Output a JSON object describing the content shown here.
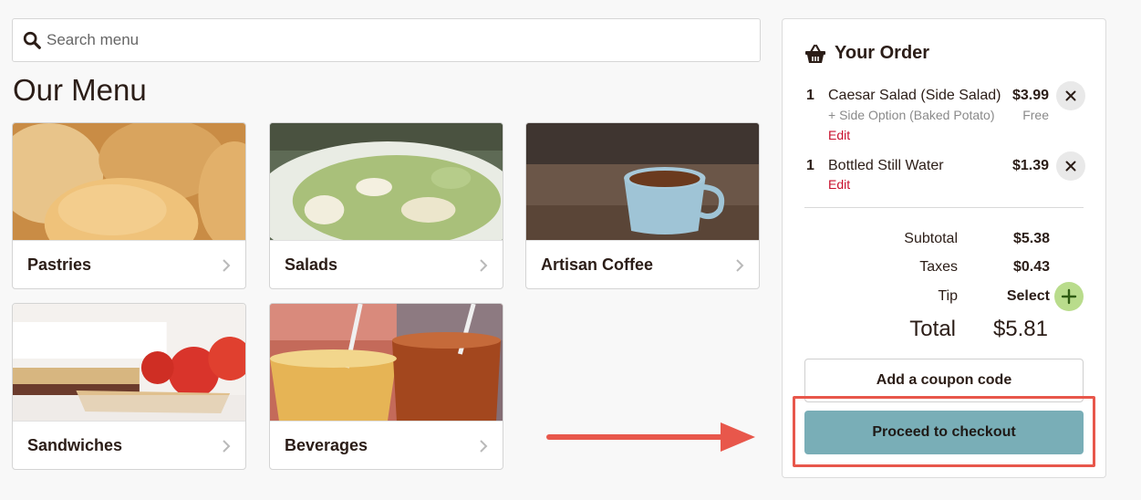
{
  "search": {
    "placeholder": "Search menu"
  },
  "menu": {
    "title": "Our Menu",
    "categories": [
      {
        "label": "Pastries"
      },
      {
        "label": "Salads"
      },
      {
        "label": "Artisan Coffee"
      },
      {
        "label": "Sandwiches"
      },
      {
        "label": "Beverages"
      }
    ]
  },
  "order": {
    "title": "Your Order",
    "items": [
      {
        "qty": "1",
        "name": "Caesar Salad (Side Salad)",
        "price": "$3.99",
        "option": "+ Side Option (Baked Potato)",
        "option_price": "Free",
        "edit_label": "Edit"
      },
      {
        "qty": "1",
        "name": "Bottled Still Water",
        "price": "$1.39",
        "edit_label": "Edit"
      }
    ],
    "subtotal_label": "Subtotal",
    "subtotal": "$5.38",
    "taxes_label": "Taxes",
    "taxes": "$0.43",
    "tip_label": "Tip",
    "tip_value": "Select",
    "total_label": "Total",
    "total": "$5.81",
    "coupon_label": "Add a coupon code",
    "checkout_label": "Proceed to checkout"
  },
  "colors": {
    "accent_checkout": "#79aeb7",
    "highlight": "#e8574b",
    "tip_button": "#b9dc8c",
    "edit_link": "#c8102e"
  },
  "icons": [
    "search-icon",
    "basket-icon",
    "chevron-right-icon",
    "close-icon",
    "plus-icon",
    "arrow-right-icon"
  ]
}
